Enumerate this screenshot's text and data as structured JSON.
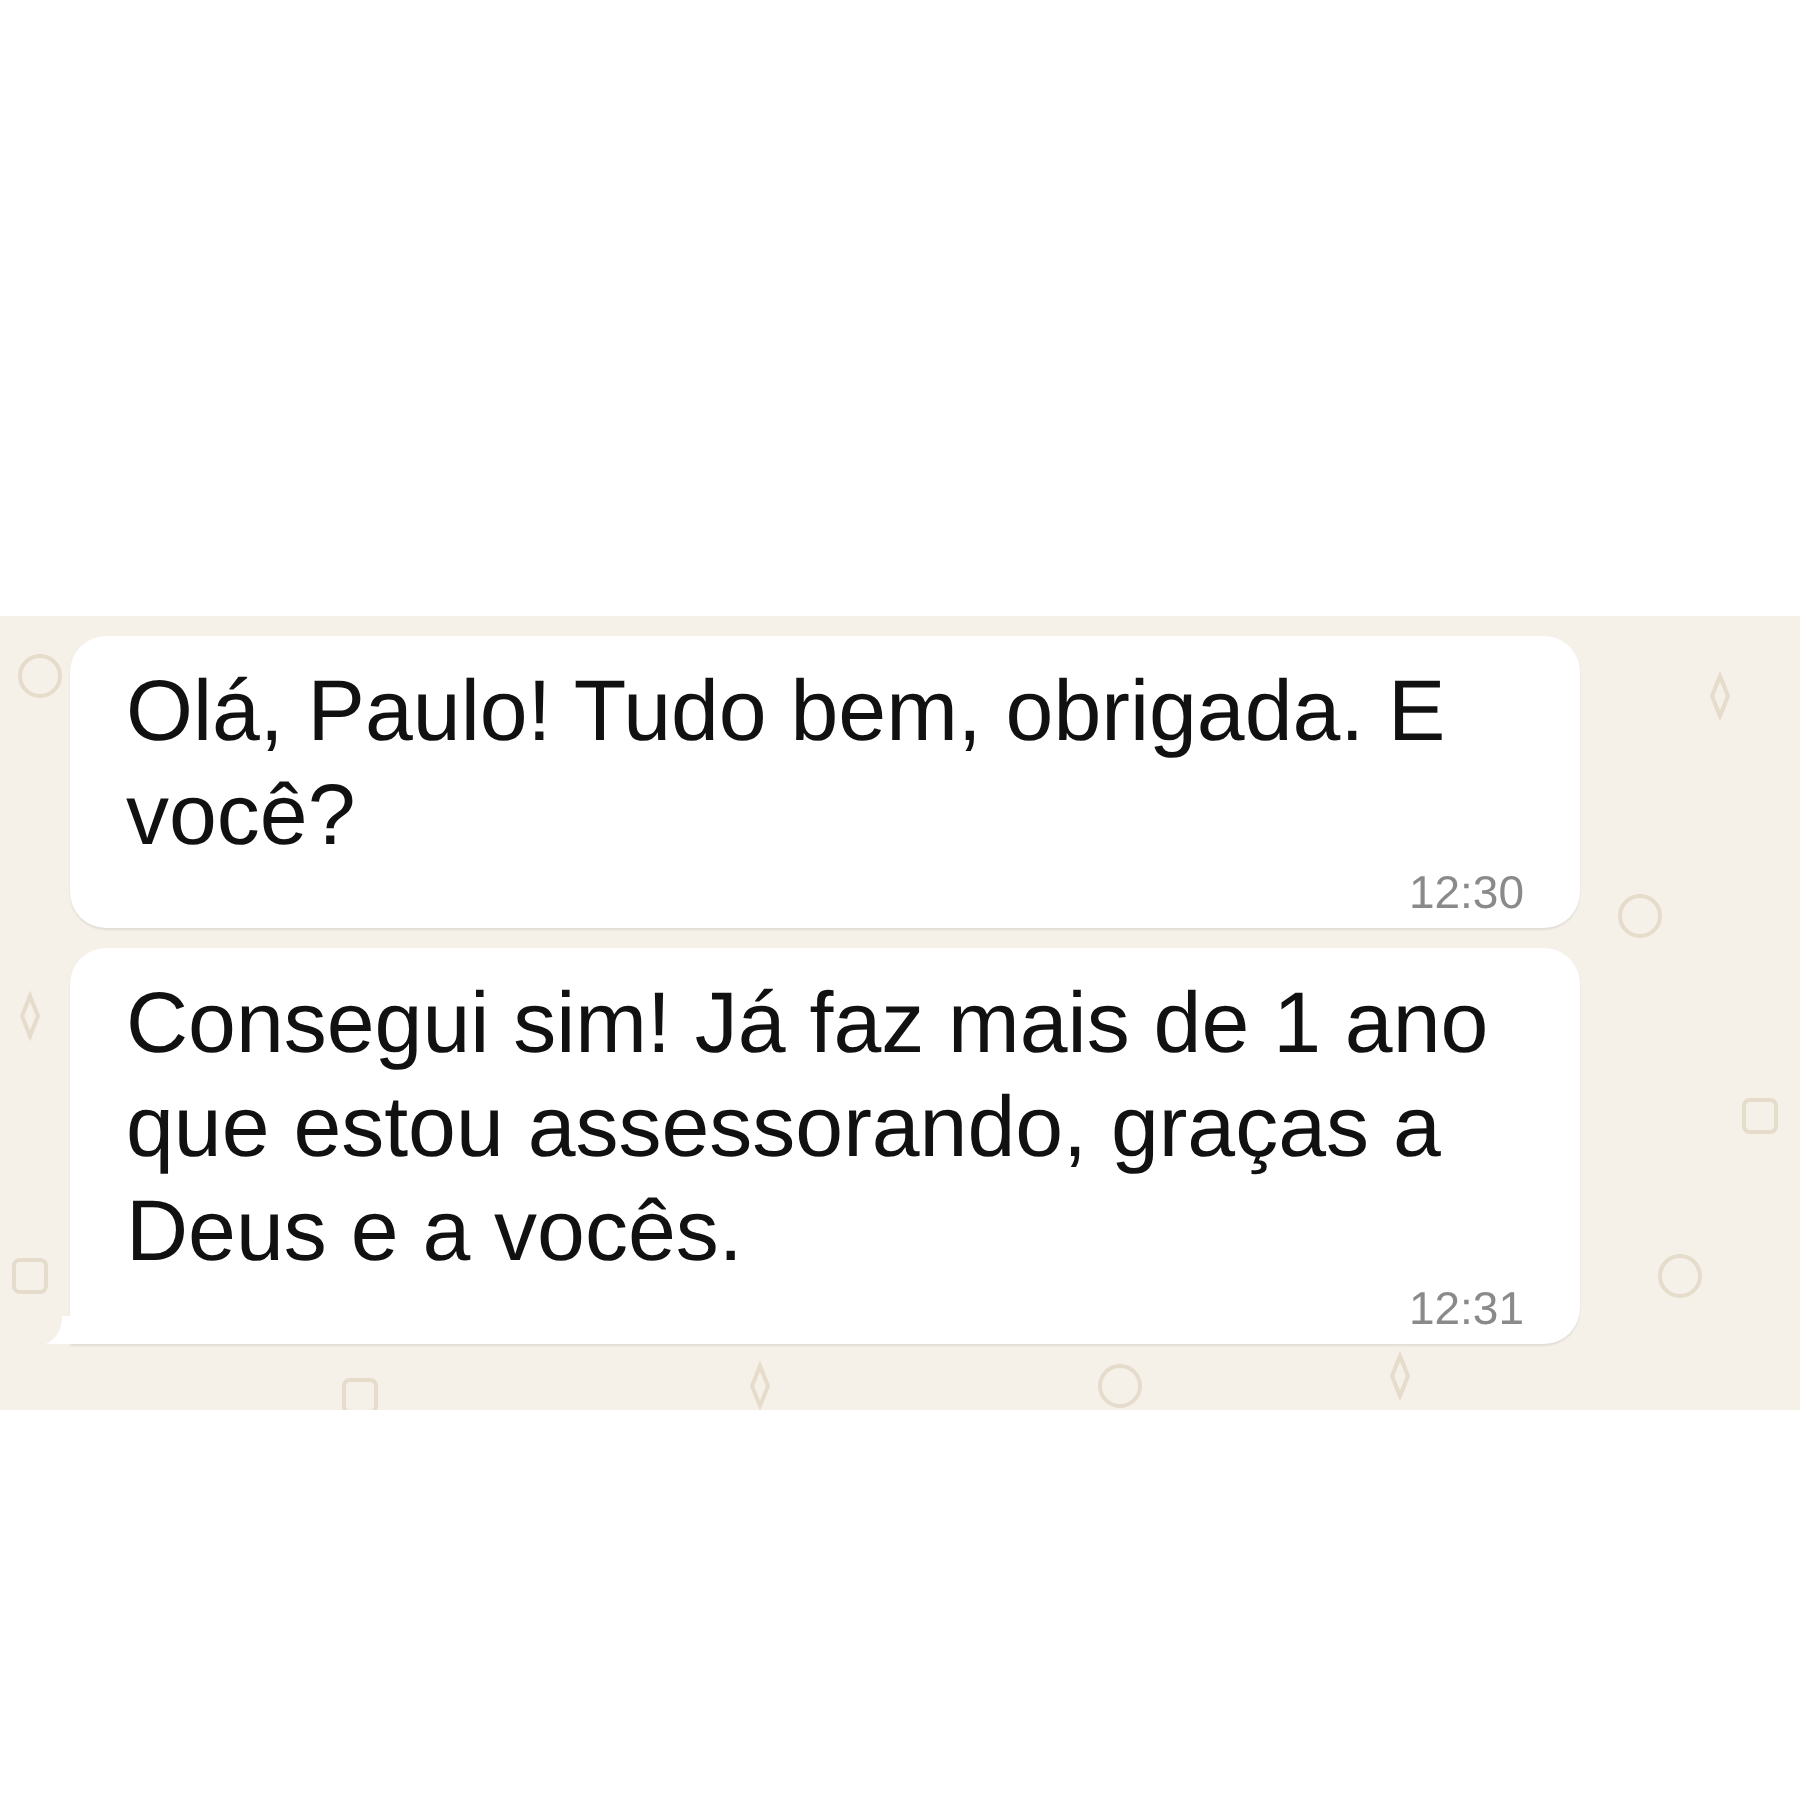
{
  "messages": [
    {
      "text": "Olá, Paulo! Tudo bem, obrigada. E você?",
      "time": "12:30",
      "tail": false
    },
    {
      "text": "Consegui sim! Já faz mais de 1 ano que estou assessorando, graças a Deus e a vocês.",
      "time": "12:31",
      "tail": true
    }
  ]
}
